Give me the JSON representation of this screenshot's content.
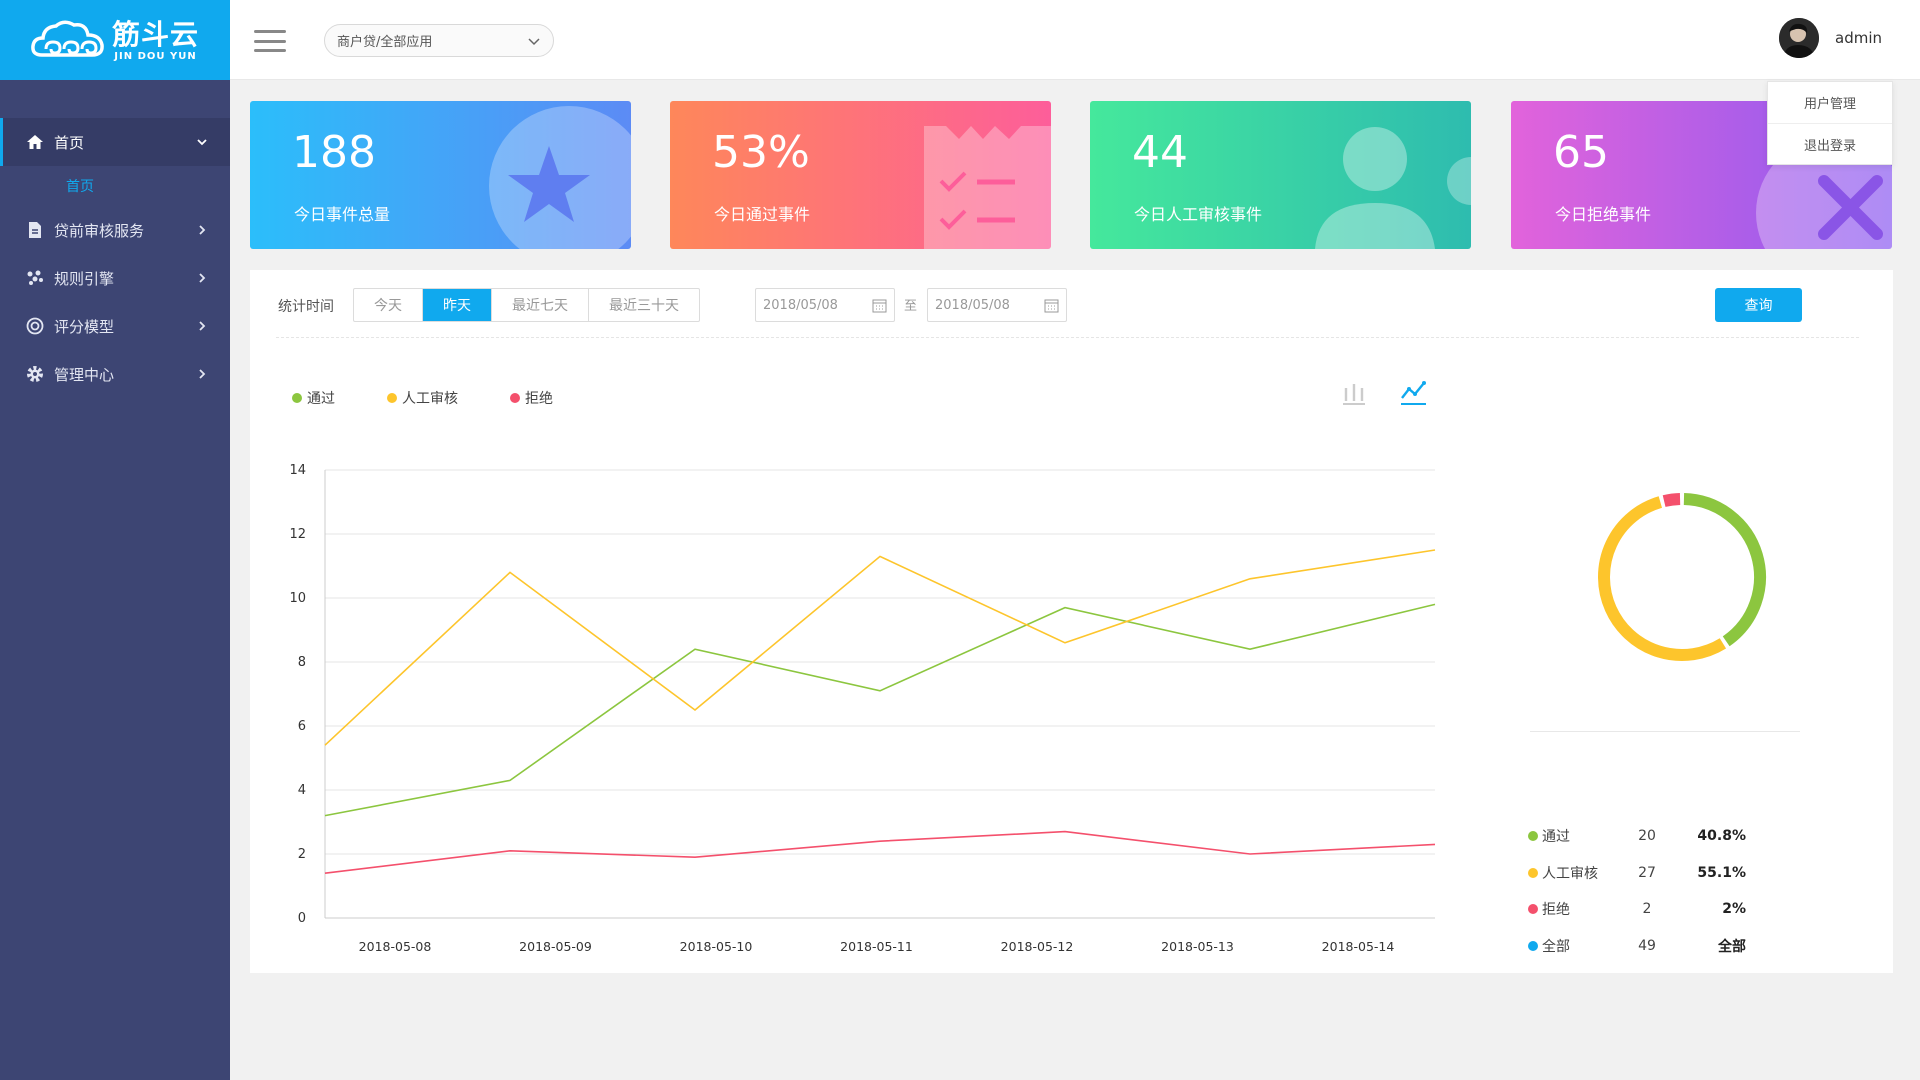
{
  "brand": {
    "name": "筋斗云",
    "sub": "JIN DOU YUN"
  },
  "sidebar": {
    "items": [
      {
        "label": "首页",
        "icon": "home-icon",
        "active": true
      },
      {
        "label": "贷前审核服务",
        "icon": "document-icon"
      },
      {
        "label": "规则引擎",
        "icon": "rules-icon"
      },
      {
        "label": "评分模型",
        "icon": "target-icon"
      },
      {
        "label": "管理中心",
        "icon": "gear-icon"
      }
    ],
    "submenu": [
      {
        "label": "首页"
      }
    ]
  },
  "header": {
    "app_select": "商户贷/全部应用",
    "username": "admin",
    "dropdown": [
      "用户管理",
      "退出登录"
    ]
  },
  "cards": [
    {
      "value": "188",
      "label": "今日事件总量",
      "icon": "star-icon"
    },
    {
      "value": "53%",
      "label": "今日通过事件",
      "icon": "checklist-icon"
    },
    {
      "value": "44",
      "label": "今日人工审核事件",
      "icon": "user-icon"
    },
    {
      "value": "65",
      "label": "今日拒绝事件",
      "icon": "x-icon"
    }
  ],
  "filter": {
    "label": "统计时间",
    "tabs": [
      "今天",
      "昨天",
      "最近七天",
      "最近三十天"
    ],
    "active_tab": 1,
    "date_from": "2018/05/08",
    "date_to": "2018/05/08",
    "date_sep": "至",
    "query_label": "查询"
  },
  "colors": {
    "pass": "#8cc63f",
    "manual": "#fdc52c",
    "reject": "#f4506c",
    "all": "#10a9ee",
    "accent": "#10a9ee"
  },
  "chart_data": [
    {
      "type": "line",
      "categories": [
        "2018-05-08",
        "2018-05-09",
        "2018-05-10",
        "2018-05-11",
        "2018-05-12",
        "2018-05-13",
        "2018-05-14"
      ],
      "series": [
        {
          "name": "通过",
          "color": "#8cc63f",
          "values": [
            3.2,
            4.3,
            8.4,
            7.1,
            9.7,
            8.4,
            9.8
          ]
        },
        {
          "name": "人工审核",
          "color": "#fdc52c",
          "values": [
            5.4,
            10.8,
            6.5,
            11.3,
            8.6,
            10.6,
            11.5
          ]
        },
        {
          "name": "拒绝",
          "color": "#f4506c",
          "values": [
            1.4,
            2.1,
            1.9,
            2.4,
            2.7,
            2.0,
            2.3
          ]
        }
      ],
      "ylim": [
        0,
        14
      ],
      "yticks": [
        0,
        2,
        4,
        6,
        8,
        10,
        12,
        14
      ],
      "grid": true,
      "legend": "top-left"
    },
    {
      "type": "pie",
      "donut": true,
      "slices": [
        {
          "name": "通过",
          "count": "20",
          "pct": "40.8%",
          "value": 20,
          "color": "#8cc63f"
        },
        {
          "name": "人工审核",
          "count": "27",
          "pct": "55.1%",
          "value": 27,
          "color": "#fdc52c"
        },
        {
          "name": "拒绝",
          "count": "2",
          "pct": "2%",
          "value": 2,
          "color": "#f4506c"
        }
      ],
      "total": {
        "name": "全部",
        "count": "49",
        "pct": "全部",
        "color": "#10a9ee"
      }
    }
  ]
}
